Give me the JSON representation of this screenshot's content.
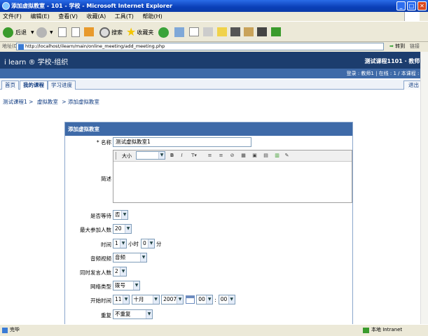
{
  "window": {
    "title": "添加虚拟教室 - 101 - 学校 - Microsoft Internet Explorer"
  },
  "menu": [
    "文件(F)",
    "编辑(E)",
    "查看(V)",
    "收藏(A)",
    "工具(T)",
    "帮助(H)"
  ],
  "toolbar": {
    "back": "后退",
    "search": "搜索",
    "favorites": "收藏夹"
  },
  "address": {
    "label": "地址(D)",
    "url": "http://localhost/ilearn/main/online_meeting/add_meeting.php",
    "go": "转到",
    "links": "链接"
  },
  "header": {
    "logo": "i learn ® 学校-组织",
    "course": "测试课程1101 · 教师1",
    "subline": "登录 : 教师1 | 在线 : 1 / 本课程 : 1"
  },
  "tabs": [
    {
      "label": "首页"
    },
    {
      "label": "我的课程"
    },
    {
      "label": "学习进度"
    }
  ],
  "logout": "退出",
  "breadcrumb": [
    "测试课程1 >",
    "虚拟教室",
    "> 添加虚拟教室"
  ],
  "form": {
    "title": "添加虚拟教室",
    "name_label": "* 名称",
    "name_value": "测试虚拟教室1",
    "desc_label": "简述",
    "editor_size": "大小",
    "wait_label": "是否等待",
    "wait_value": "否",
    "max_label": "最大参加人数",
    "max_value": "20",
    "time_label": "时间",
    "hours_value": "1",
    "hours_unit": "小时",
    "minutes_value": "0",
    "minutes_unit": "分",
    "av_label": "音频视频",
    "av_value": "音频",
    "speakers_label": "同时发言人数",
    "speakers_value": "2",
    "net_label": "网络类型",
    "net_value": "拨号",
    "start_label": "开始时间",
    "day_value": "11",
    "month_value": "十月",
    "year_value": "2007",
    "hour_value": "00",
    "min_value": "00",
    "repeat_label": "重复",
    "repeat_value": "不重复"
  },
  "status": {
    "left": "完毕",
    "right": "本地 Intranet"
  }
}
